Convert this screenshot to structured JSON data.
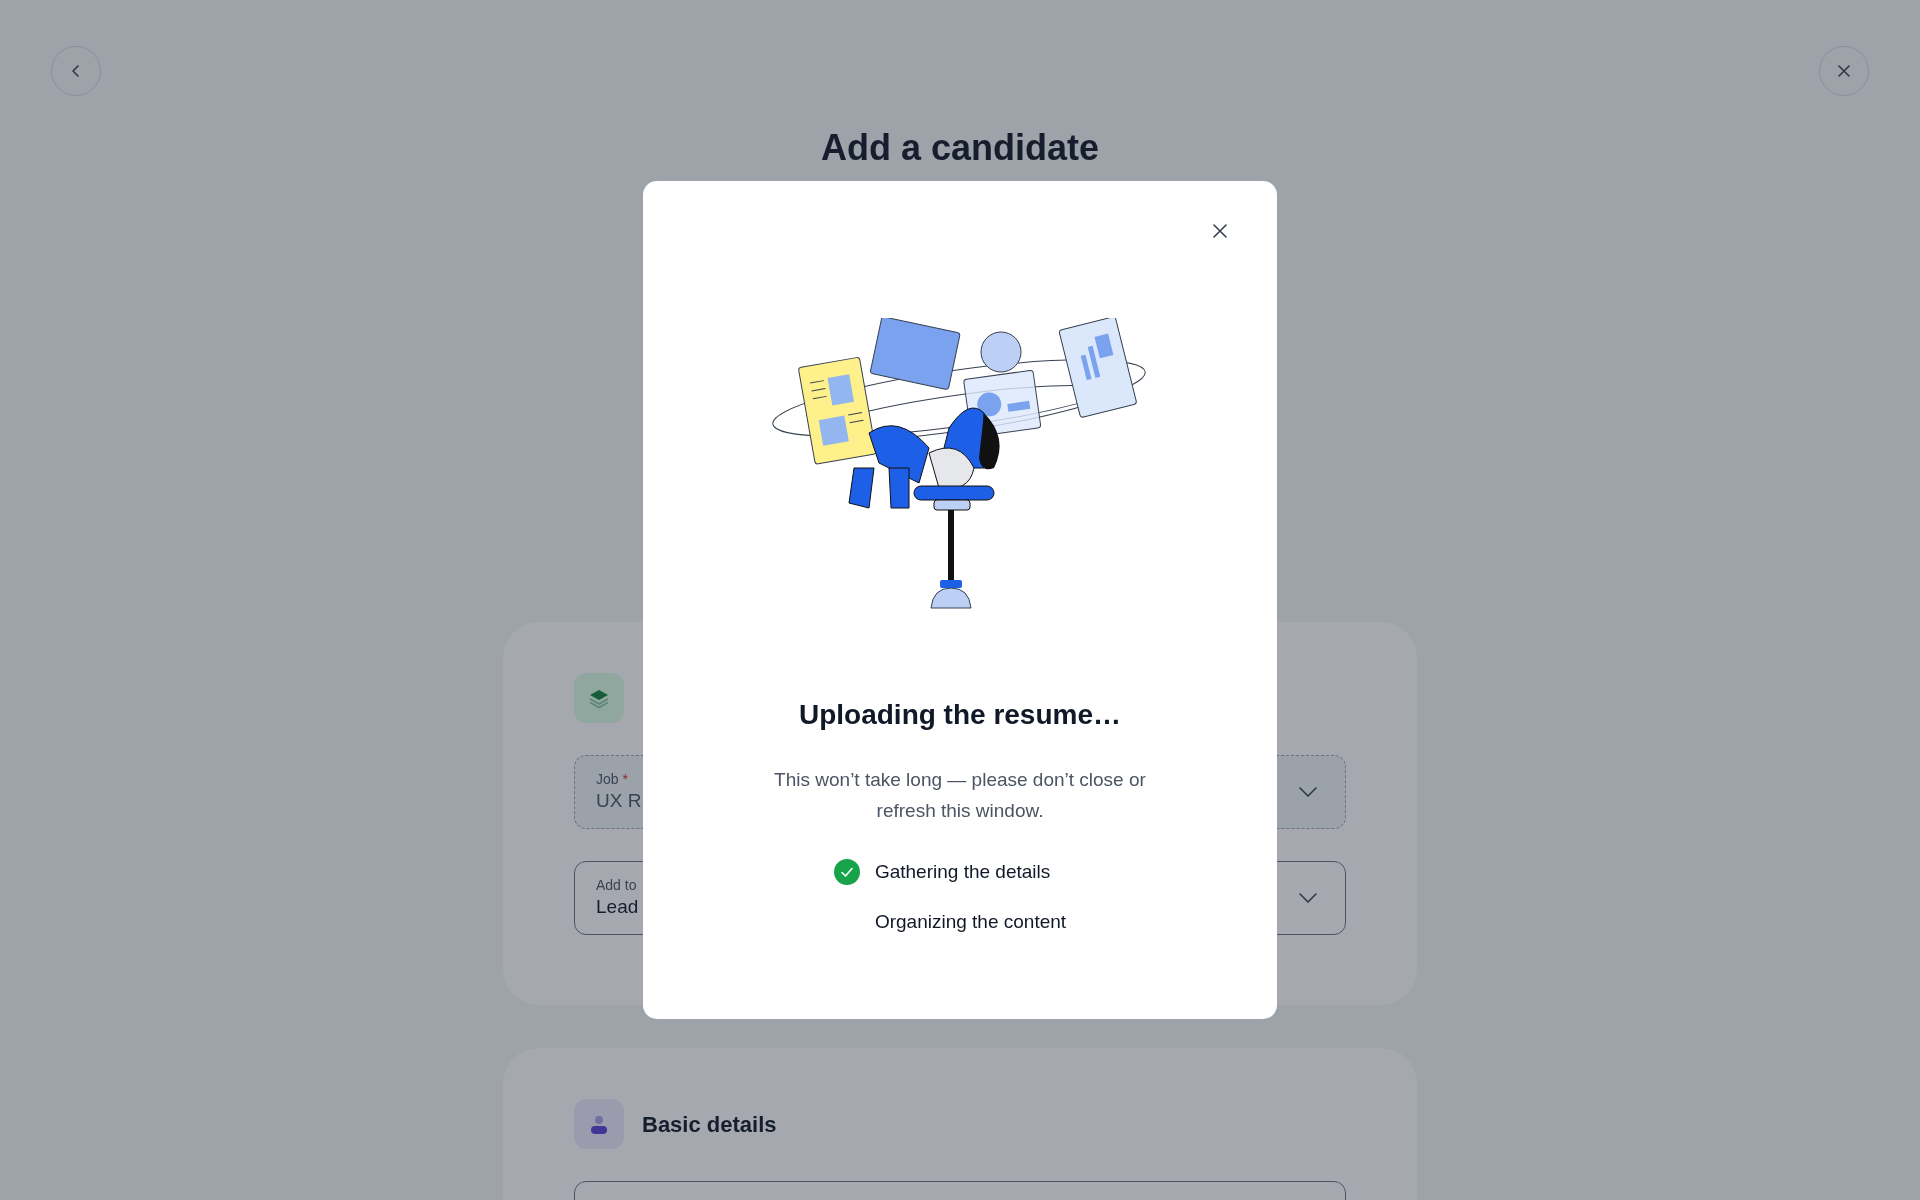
{
  "page_title": "Add a candidate",
  "sections": [
    {
      "fields": [
        {
          "kind": "select",
          "label": "Job",
          "required_mark": "*",
          "disabled": true,
          "value": "UX R"
        },
        {
          "kind": "select",
          "label": "Add to",
          "disabled": false,
          "value": "Lead"
        }
      ]
    },
    {
      "heading": "Basic details",
      "fields": [
        {
          "kind": "blank"
        }
      ]
    }
  ],
  "modal": {
    "title": "Uploading the resume…",
    "message": "This won’t take long — please don’t close or refresh this window.",
    "steps": [
      {
        "label": "Gathering the details",
        "done": true
      },
      {
        "label": "Organizing the content",
        "done": false
      }
    ]
  }
}
